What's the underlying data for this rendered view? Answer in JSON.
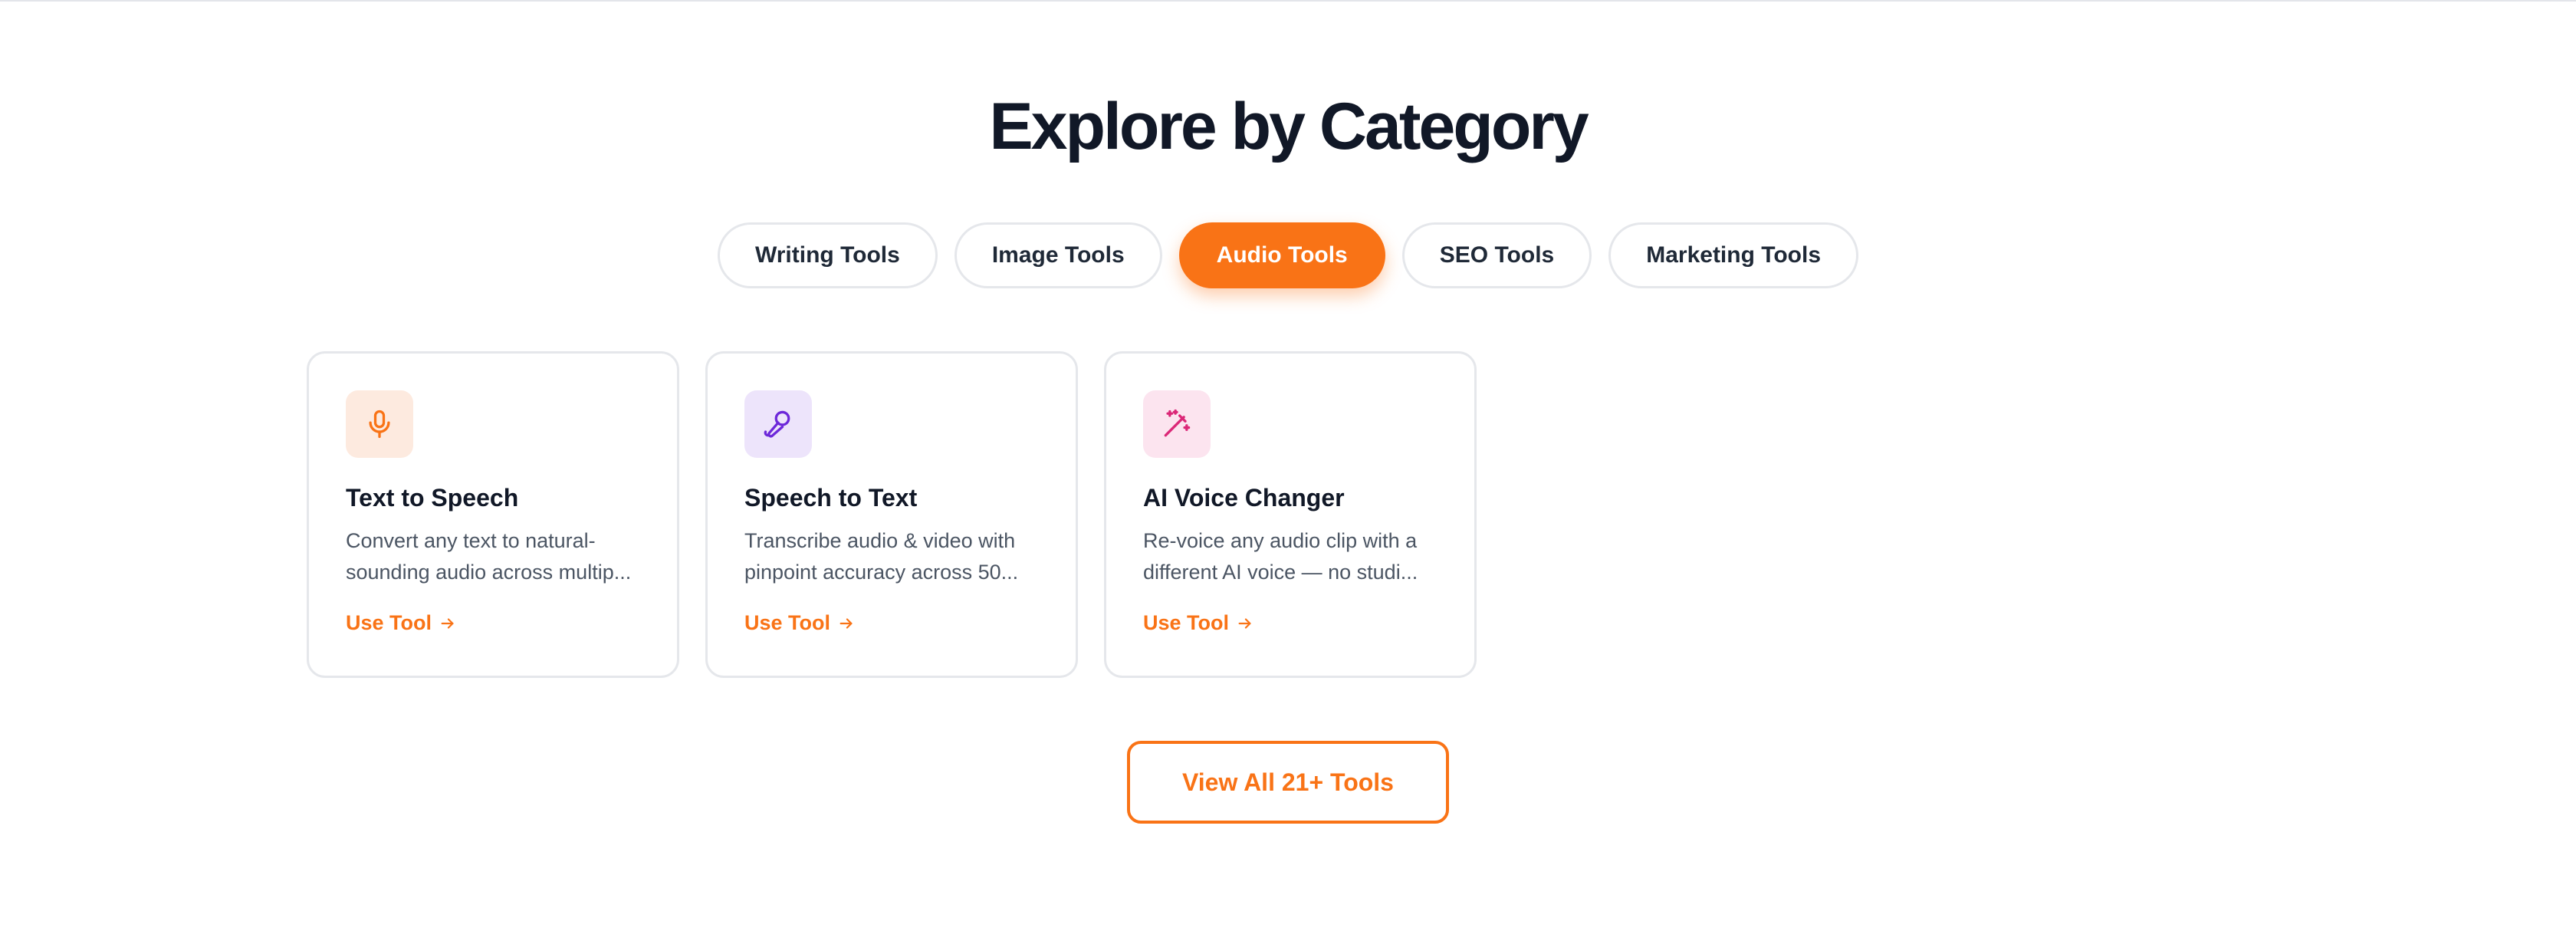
{
  "section": {
    "title": "Explore by Category"
  },
  "tabs": [
    {
      "label": "Writing Tools",
      "active": false
    },
    {
      "label": "Image Tools",
      "active": false
    },
    {
      "label": "Audio Tools",
      "active": true
    },
    {
      "label": "SEO Tools",
      "active": false
    },
    {
      "label": "Marketing Tools",
      "active": false
    }
  ],
  "cards": [
    {
      "icon": "microphone-icon",
      "icon_color": "#f97316",
      "icon_bg": "#fdeadf",
      "title": "Text to Speech",
      "description": "Convert any text to natural-sounding audio across multip...",
      "link_label": "Use Tool"
    },
    {
      "icon": "mic-pen-icon",
      "icon_color": "#6d28d9",
      "icon_bg": "#ede4fb",
      "title": "Speech to Text",
      "description": "Transcribe audio & video with pinpoint accuracy across 50...",
      "link_label": "Use Tool"
    },
    {
      "icon": "magic-wand-icon",
      "icon_color": "#db2777",
      "icon_bg": "#fce4ef",
      "title": "AI Voice Changer",
      "description": "Re-voice any audio clip with a different AI voice — no studi...",
      "link_label": "Use Tool"
    }
  ],
  "view_all": {
    "label": "View All 21+ Tools"
  },
  "colors": {
    "accent": "#f97316",
    "heading": "#111827",
    "body_text": "#4b5563",
    "border": "#e5e7eb"
  }
}
